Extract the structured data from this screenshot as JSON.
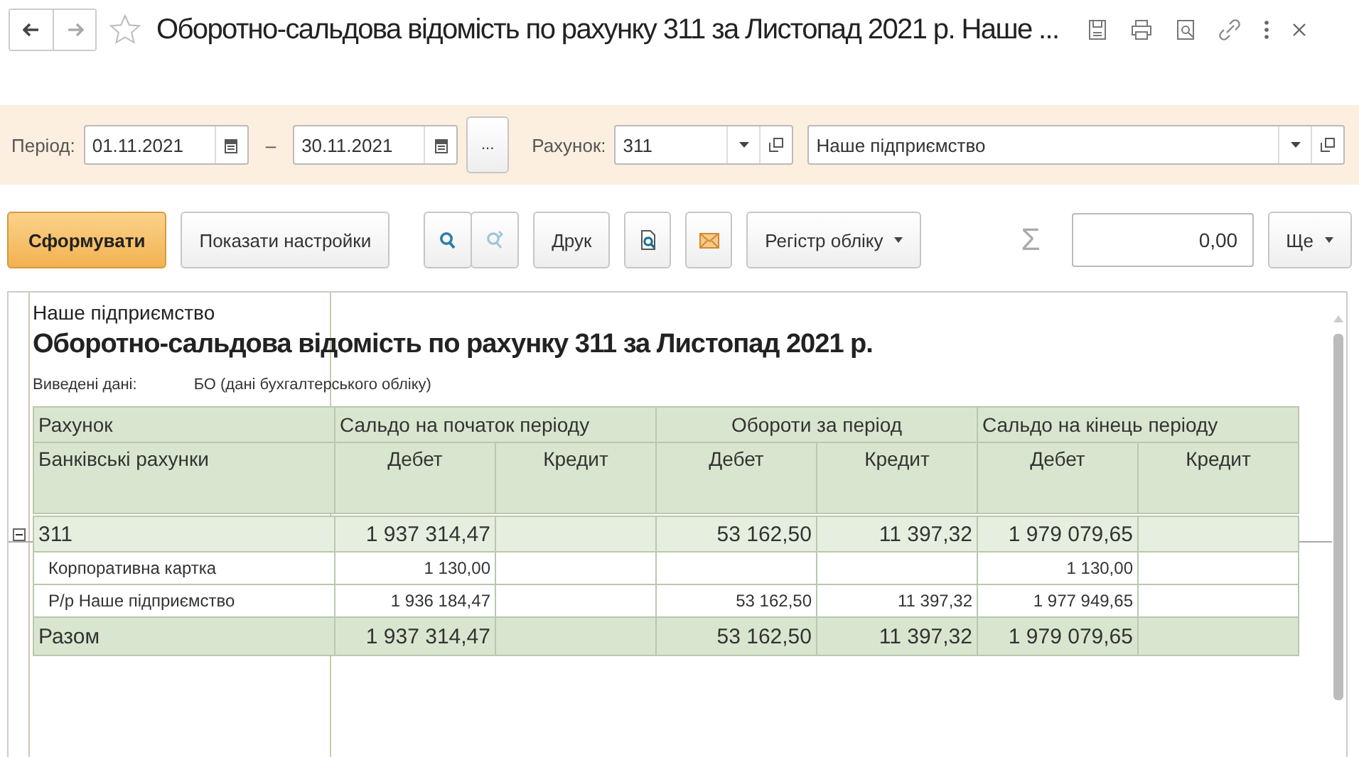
{
  "window": {
    "title": "Оборотно-сальдова відомість по рахунку 311 за Листопад 2021 р. Наше ..."
  },
  "filters": {
    "period_label": "Період:",
    "date_from": "01.11.2021",
    "separator": "–",
    "date_to": "30.11.2021",
    "more_button": "...",
    "account_label": "Рахунок:",
    "account": "311",
    "organization": "Наше підприємство"
  },
  "toolbar": {
    "generate_button": "Сформувати",
    "settings_button": "Показати настройки",
    "print_button": "Друк",
    "register_button": "Регістр обліку",
    "sum_sign": "Σ",
    "sum_value": "0,00",
    "more_button": "Ще"
  },
  "report": {
    "organization": "Наше підприємство",
    "title": "Оборотно-сальдова відомість по рахунку 311 за Листопад 2021 р.",
    "output_label": "Виведені дані:",
    "output_value": "БО (дані бухгалтерського обліку)",
    "header_groups": [
      "Рахунок",
      "Сальдо на початок періоду",
      "Обороти за період",
      "Сальдо на кінець періоду"
    ],
    "subheader_first": "Банківські рахунки",
    "subheaders": [
      "Дебет",
      "Кредит",
      "Дебет",
      "Кредит",
      "Дебет",
      "Кредит"
    ],
    "rows": [
      {
        "kind": "group",
        "account": "311",
        "expanded": true,
        "values": {
          "start_debit": "1 937 314,47",
          "turnover_debit": "53 162,50",
          "turnover_credit": "11 397,32",
          "end_debit": "1 979 079,65"
        },
        "children": [
          {
            "kind": "detail",
            "account": "Корпоративна картка",
            "values": {
              "start_debit": "1 130,00",
              "end_debit": "1 130,00"
            }
          },
          {
            "kind": "detail",
            "account": "Р/р Наше підприємство",
            "values": {
              "start_debit": "1 936 184,47",
              "turnover_debit": "53 162,50",
              "turnover_credit": "11 397,32",
              "end_debit": "1 977 949,65"
            }
          }
        ]
      },
      {
        "kind": "total",
        "account": "Разом",
        "values": {
          "start_debit": "1 937 314,47",
          "turnover_debit": "53 162,50",
          "turnover_credit": "11 397,32",
          "end_debit": "1 979 079,65"
        }
      }
    ]
  }
}
